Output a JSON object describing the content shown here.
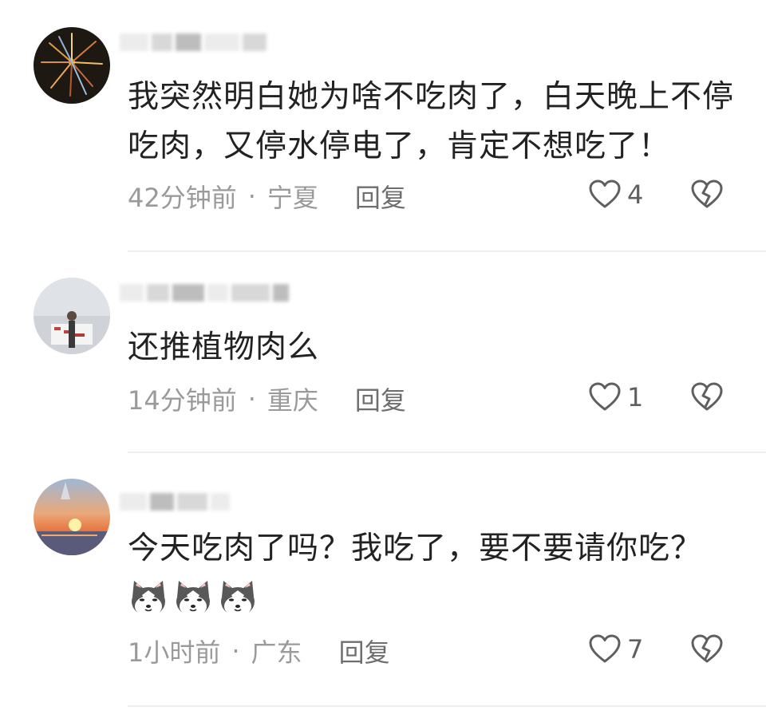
{
  "comments": [
    {
      "text": "我突然明白她为啥不吃肉了，白天晚上不停吃肉，又停水停电了，肯定不想吃了！",
      "time": "42分钟前",
      "location": "宁夏",
      "reply_label": "回复",
      "likes": "4",
      "emojis": []
    },
    {
      "text": "还推植物肉么",
      "time": "14分钟前",
      "location": "重庆",
      "reply_label": "回复",
      "likes": "1",
      "emojis": []
    },
    {
      "text": "今天吃肉了吗？我吃了，要不要请你吃？",
      "time": "1小时前",
      "location": "广东",
      "reply_label": "回复",
      "likes": "7",
      "emojis": [
        "husky-dog-emoji",
        "husky-dog-emoji",
        "husky-dog-emoji"
      ]
    }
  ],
  "separator": "·",
  "icons": {
    "like": "heart-outline-icon",
    "dislike": "broken-heart-icon"
  },
  "colors": {
    "text": "#222222",
    "meta": "#9a9a9a",
    "reply": "#6e6e6e",
    "icon": "#5f5f5f",
    "divider": "#efefef"
  }
}
